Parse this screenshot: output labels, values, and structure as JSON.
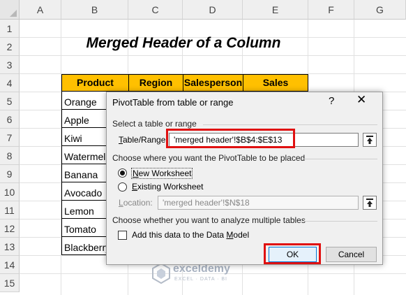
{
  "sheet": {
    "columns": [
      "A",
      "B",
      "C",
      "D",
      "E",
      "F",
      "G"
    ],
    "rows": [
      "1",
      "2",
      "3",
      "4",
      "5",
      "6",
      "7",
      "8",
      "9",
      "10",
      "11",
      "12",
      "13",
      "14",
      "15"
    ],
    "title": "Merged Header of a Column",
    "headers": [
      "Product",
      "Region",
      "Salesperson",
      "Sales"
    ],
    "products": [
      "Orange",
      "Apple",
      "Kiwi",
      "Watermelon",
      "Banana",
      "Avocado",
      "Lemon",
      "Tomato",
      "Blackberry"
    ]
  },
  "dialog": {
    "title": "PivotTable from table or range",
    "help": "?",
    "close": "✕",
    "section1": "Select a table or range",
    "table_range_label": "Table/Range:",
    "table_range_value": "'merged header'!$B$4:$E$13",
    "section2": "Choose where you want the PivotTable to be placed",
    "new_worksheet": "New Worksheet",
    "existing_worksheet": "Existing Worksheet",
    "location_label": "Location:",
    "location_value": "'merged header'!$N$18",
    "section3": "Choose whether you want to analyze multiple tables",
    "data_model": "Add this data to the Data Model",
    "ok": "OK",
    "cancel": "Cancel",
    "placement_selected": "New Worksheet"
  },
  "watermark": {
    "name": "exceldemy",
    "tagline": "EXCEL · DATA · BI"
  },
  "colors": {
    "header_fill": "#ffc000",
    "highlight": "#e01010"
  }
}
